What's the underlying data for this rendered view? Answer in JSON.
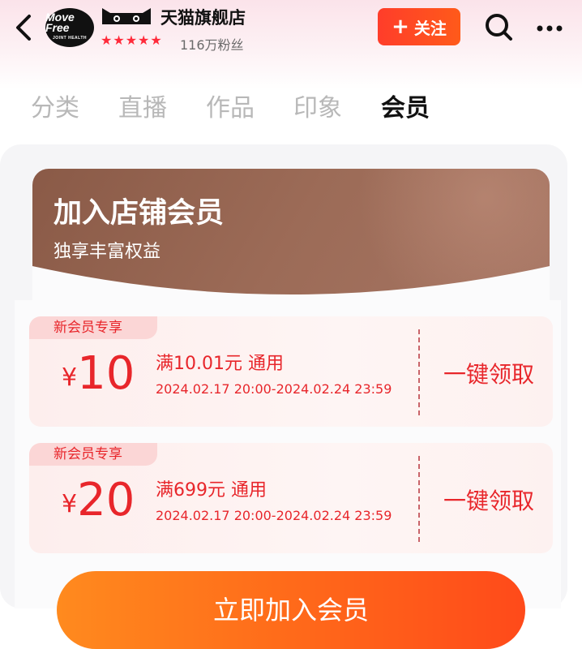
{
  "header": {
    "logo_text": "Move Free",
    "logo_subtext": "JOINT HEALTH",
    "store_name": "天猫旗舰店",
    "rating_stars": 5,
    "fans": "116万粉丝",
    "follow_label": "关注"
  },
  "tabs": [
    {
      "label": "分类",
      "active": false
    },
    {
      "label": "直播",
      "active": false
    },
    {
      "label": "作品",
      "active": false
    },
    {
      "label": "印象",
      "active": false
    },
    {
      "label": "会员",
      "active": true
    }
  ],
  "member": {
    "title": "加入店铺会员",
    "subtitle": "独享丰富权益",
    "coupons": [
      {
        "tag": "新会员专享",
        "currency": "¥",
        "amount": "10",
        "condition": "满10.01元 通用",
        "period": "2024.02.17 20:00-2024.02.24 23:59",
        "action": "一键领取"
      },
      {
        "tag": "新会员专享",
        "currency": "¥",
        "amount": "20",
        "condition": "满699元 通用",
        "period": "2024.02.17 20:00-2024.02.24 23:59",
        "action": "一键领取"
      }
    ],
    "join_label": "立即加入会员"
  },
  "colors": {
    "accent_red": "#e8262b",
    "follow_orange": "#ff4a22",
    "banner_brown": "#94634f",
    "join_orange": "#ff7a1e"
  }
}
